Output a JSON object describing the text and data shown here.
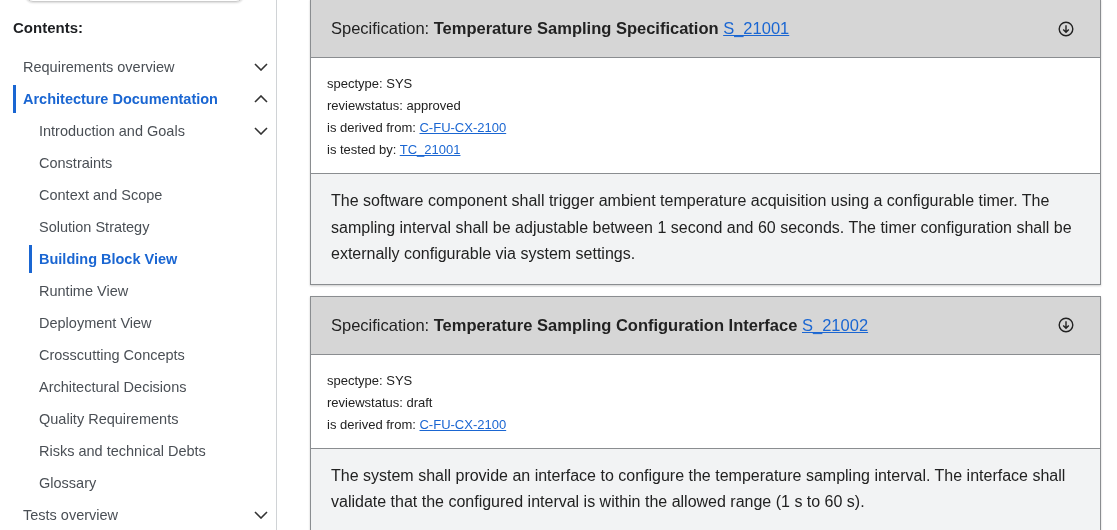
{
  "sidebar": {
    "heading": "Contents:",
    "items": [
      {
        "label": "Requirements overview",
        "selected": false,
        "expanded": false
      },
      {
        "label": "Architecture Documentation",
        "selected": true,
        "expanded": true,
        "children": [
          {
            "label": "Introduction and Goals",
            "selected": false,
            "expanded": false
          },
          {
            "label": "Constraints",
            "selected": false
          },
          {
            "label": "Context and Scope",
            "selected": false
          },
          {
            "label": "Solution Strategy",
            "selected": false
          },
          {
            "label": "Building Block View",
            "selected": true
          },
          {
            "label": "Runtime View",
            "selected": false
          },
          {
            "label": "Deployment View",
            "selected": false
          },
          {
            "label": "Crosscutting Concepts",
            "selected": false
          },
          {
            "label": "Architectural Decisions",
            "selected": false
          },
          {
            "label": "Quality Requirements",
            "selected": false
          },
          {
            "label": "Risks and technical Debts",
            "selected": false
          },
          {
            "label": "Glossary",
            "selected": false
          }
        ]
      },
      {
        "label": "Tests overview",
        "selected": false,
        "expanded": false
      }
    ]
  },
  "specifications": [
    {
      "type_label": "Specification:",
      "title": "Temperature Sampling Specification",
      "id": "S_21001",
      "meta": [
        {
          "label": "spectype:",
          "value": "SYS"
        },
        {
          "label": "reviewstatus:",
          "value": "approved"
        },
        {
          "label": "is derived from:",
          "link": "C-FU-CX-2100"
        },
        {
          "label": "is tested by:",
          "link": "TC_21001"
        }
      ],
      "description": "The software component shall trigger ambient temperature acquisition using a configurable timer. The sampling interval shall be adjustable between 1 second and 60 seconds. The timer configuration shall be externally configurable via system settings."
    },
    {
      "type_label": "Specification:",
      "title": "Temperature Sampling Configuration Interface",
      "id": "S_21002",
      "meta": [
        {
          "label": "spectype:",
          "value": "SYS"
        },
        {
          "label": "reviewstatus:",
          "value": "draft"
        },
        {
          "label": "is derived from:",
          "link": "C-FU-CX-2100"
        }
      ],
      "description": "The system shall provide an interface to configure the temperature sampling interval. The interface shall validate that the configured interval is within the allowed range (1 s to 60 s)."
    }
  ]
}
